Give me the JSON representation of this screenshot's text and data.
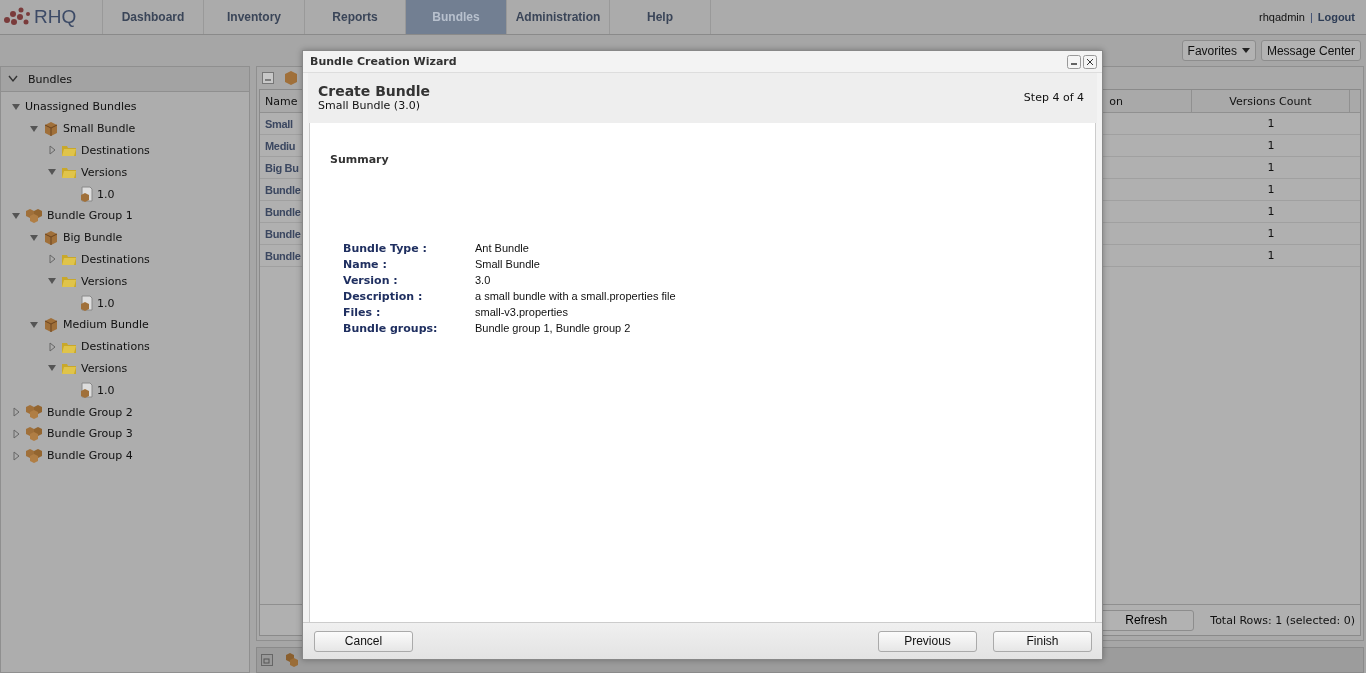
{
  "nav": {
    "logo": "RHQ",
    "tabs": [
      {
        "label": "Dashboard",
        "selected": false
      },
      {
        "label": "Inventory",
        "selected": false
      },
      {
        "label": "Reports",
        "selected": false
      },
      {
        "label": "Bundles",
        "selected": true
      },
      {
        "label": "Administration",
        "selected": false
      },
      {
        "label": "Help",
        "selected": false
      }
    ],
    "user": "rhqadmin",
    "separator": "|",
    "logout": "Logout"
  },
  "toolbar": [
    {
      "label": "Favorites",
      "kind": "dropdown"
    },
    {
      "label": "Message Center",
      "kind": "button"
    }
  ],
  "tree": {
    "title": "Bundles",
    "items": [
      {
        "label": "Unassigned Bundles",
        "kind": "root",
        "expanded": true,
        "children": [
          {
            "label": "Small Bundle",
            "kind": "bundle",
            "expanded": true,
            "children": [
              {
                "label": "Destinations",
                "kind": "folder",
                "expanded": false
              },
              {
                "label": "Versions",
                "kind": "folder",
                "expanded": true,
                "children": [
                  {
                    "label": "1.0",
                    "kind": "version"
                  }
                ]
              }
            ]
          }
        ]
      },
      {
        "label": "Bundle Group 1",
        "kind": "group",
        "expanded": true,
        "children": [
          {
            "label": "Big Bundle",
            "kind": "bundle",
            "expanded": true,
            "children": [
              {
                "label": "Destinations",
                "kind": "folder",
                "expanded": false
              },
              {
                "label": "Versions",
                "kind": "folder",
                "expanded": true,
                "children": [
                  {
                    "label": "1.0",
                    "kind": "version"
                  }
                ]
              }
            ]
          },
          {
            "label": "Medium Bundle",
            "kind": "bundle",
            "expanded": true,
            "children": [
              {
                "label": "Destinations",
                "kind": "folder",
                "expanded": false
              },
              {
                "label": "Versions",
                "kind": "folder",
                "expanded": true,
                "children": [
                  {
                    "label": "1.0",
                    "kind": "version"
                  }
                ]
              }
            ]
          }
        ]
      },
      {
        "label": "Bundle Group 2",
        "kind": "group",
        "expanded": false
      },
      {
        "label": "Bundle Group 3",
        "kind": "group",
        "expanded": false
      },
      {
        "label": "Bundle Group 4",
        "kind": "group",
        "expanded": false
      }
    ]
  },
  "table": {
    "columns": [
      "Name",
      "on",
      "Versions Count"
    ],
    "rows": [
      {
        "name": "Small",
        "count": "1"
      },
      {
        "name": "Mediu",
        "count": "1"
      },
      {
        "name": "Big Bu",
        "count": "1"
      },
      {
        "name": "Bundle",
        "count": "1"
      },
      {
        "name": "Bundle",
        "count": "1"
      },
      {
        "name": "Bundle",
        "count": "1"
      },
      {
        "name": "Bundle",
        "count": "1"
      }
    ],
    "refresh": "Refresh",
    "total": "Total Rows: 1 (selected: 0)"
  },
  "dialog": {
    "title": "Bundle Creation Wizard",
    "heading": "Create Bundle",
    "subtitle": "Small Bundle (3.0)",
    "step": "Step 4 of 4",
    "section": "Summary",
    "fields": [
      {
        "label": "Bundle Type :",
        "value": "Ant Bundle"
      },
      {
        "label": "Name :",
        "value": "Small Bundle"
      },
      {
        "label": "Version :",
        "value": "3.0"
      },
      {
        "label": "Description :",
        "value": "a small bundle with a small.properties file"
      },
      {
        "label": "Files :",
        "value": "small-v3.properties"
      },
      {
        "label": "Bundle groups:",
        "value": "Bundle group 1, Bundle group 2"
      }
    ],
    "buttons": {
      "cancel": "Cancel",
      "previous": "Previous",
      "finish": "Finish"
    }
  }
}
